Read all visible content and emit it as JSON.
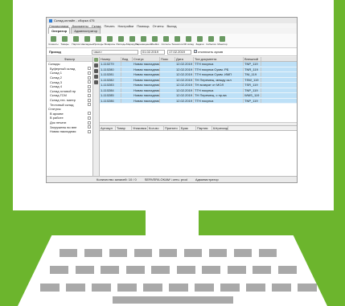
{
  "app": {
    "title": "Склад-онлайн - сборка 475",
    "menu": [
      "Справочники",
      "Документы",
      "Склад",
      "Печать",
      "Настройки",
      "Помощь",
      "Отчеты",
      "Выход"
    ],
    "tabs": [
      "Оператор",
      "Администратор"
    ],
    "toolbar": [
      "Клиенты",
      "Товары",
      "Партии",
      "Накладные",
      "Приходы",
      "Возвраты",
      "Расходы",
      "Маршруты",
      "Перемещения",
      "Ячейки",
      "Сотчеты",
      "Технологи",
      "3D склад",
      "Задачи",
      "События",
      "Монитор"
    ],
    "doc": {
      "title": "Приход",
      "type_value": "<все>",
      "date_from": "01.02.2019",
      "date_to": "17.02.2019",
      "checkbox_label": "отключить архив"
    },
    "filter": {
      "header": "Фильтр",
      "rows": [
        {
          "label": "Склады",
          "type": "grp"
        },
        {
          "label": "Буферный склад",
          "type": "sub"
        },
        {
          "label": "Склад 1",
          "type": "sub"
        },
        {
          "label": "Склад 2",
          "type": "sub"
        },
        {
          "label": "Склад 3",
          "type": "sub"
        },
        {
          "label": "Склад 4",
          "type": "sub"
        },
        {
          "label": "Склад готовой пр",
          "type": "sub"
        },
        {
          "label": "Склад ГСМ",
          "type": "sub"
        },
        {
          "label": "Склад тех. матер",
          "type": "sub"
        },
        {
          "label": "Тестовый склад",
          "type": "sub"
        },
        {
          "label": "Статусы",
          "type": "grp"
        },
        {
          "label": "В архиве",
          "type": "sub"
        },
        {
          "label": "В работе",
          "type": "sub"
        },
        {
          "label": "Док печати",
          "type": "sub"
        },
        {
          "label": "Загружены во вне",
          "type": "sub"
        },
        {
          "label": "Новая накладная",
          "type": "sub"
        }
      ]
    },
    "grid": {
      "headers": [
        "Номер",
        "Вид",
        "Статус",
        "Пояс",
        "Дата",
        "Тип документа",
        "Внешний"
      ],
      "rows": [
        [
          "1-110279",
          "",
          "Новая накладная",
          "",
          "12.02.2019",
          "ТТН покупка",
          "TNP_119"
        ],
        [
          "1-110280",
          "",
          "Новая накладная",
          "",
          "12.02.2019",
          "ТТН покупка Сумм. РБ",
          "TNR_119"
        ],
        [
          "1-110281",
          "",
          "Новая накладная",
          "",
          "12.02.2019",
          "ТТН покупка Сумм. ИМП",
          "TNI_119"
        ],
        [
          "1-110282",
          "",
          "Новая накладная",
          "",
          "12.02.2019",
          "ТН Перемещ. между скл",
          "TSW_119"
        ],
        [
          "1-110283",
          "",
          "Новая накладная",
          "",
          "12.02.2019",
          "ТН возврат от МОЛ",
          "TSR_119"
        ],
        [
          "1-110284",
          "",
          "Новая накладная",
          "",
          "12.02.2019",
          "ТТН покупка",
          "TNP_119"
        ],
        [
          "1-110285",
          "",
          "Новая накладная",
          "",
          "12.02.2019",
          "ТН Перемещ. с пр-ва",
          "WMS_119"
        ],
        [
          "1-110286",
          "",
          "Новая накладная",
          "",
          "12.02.2019",
          "ТТН покупка",
          "TNP_119"
        ]
      ]
    },
    "detail_headers": [
      "Артикул",
      "Товар",
      "Упаковка",
      "Кол-во",
      "Принято",
      "Брак",
      "Партия",
      "Штрихкод"
    ],
    "status": {
      "count": "Количество записей: 10 / 0",
      "server": "SERVER/LOKAM \\ сеть: prod",
      "role": "Администратор"
    }
  }
}
